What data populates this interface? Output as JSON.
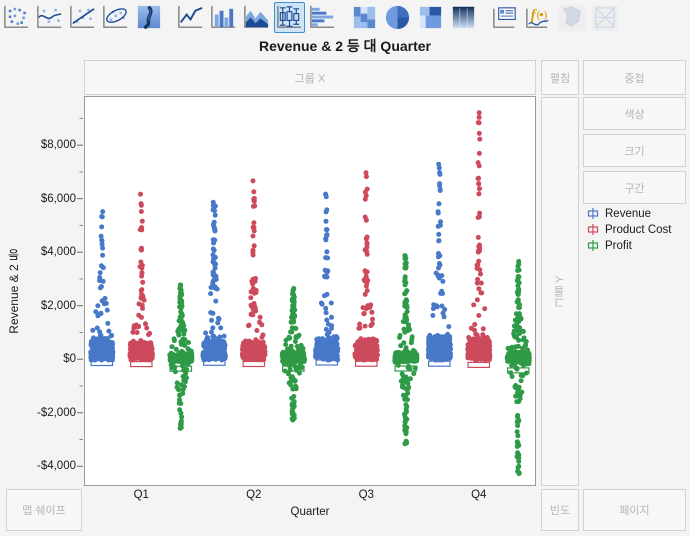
{
  "toolbar": {
    "groups": [
      {
        "name": "plot-types-1",
        "buttons": [
          {
            "icon": "scatterplot-icon",
            "label": "Scatterplot",
            "selected": false,
            "disabled": false
          },
          {
            "icon": "smoother-icon",
            "label": "Smoother",
            "selected": false,
            "disabled": false
          },
          {
            "icon": "line-of-fit-icon",
            "label": "Line of Fit",
            "selected": false,
            "disabled": false
          },
          {
            "icon": "ellipse-icon",
            "label": "Normal Ellipse",
            "selected": false,
            "disabled": false
          },
          {
            "icon": "contour-icon",
            "label": "Contour",
            "selected": false,
            "disabled": false
          }
        ]
      },
      {
        "name": "plot-types-2",
        "buttons": [
          {
            "icon": "line-chart-icon",
            "label": "Line Chart",
            "selected": false,
            "disabled": false
          },
          {
            "icon": "bar-chart-icon",
            "label": "Bar Chart",
            "selected": false,
            "disabled": false
          },
          {
            "icon": "area-chart-icon",
            "label": "Area Chart",
            "selected": false,
            "disabled": false
          },
          {
            "icon": "box-plot-icon",
            "label": "Box Plot",
            "selected": true,
            "disabled": false
          },
          {
            "icon": "histogram-icon",
            "label": "Histogram",
            "selected": false,
            "disabled": false
          }
        ]
      },
      {
        "name": "plot-types-3",
        "buttons": [
          {
            "icon": "mosaic-icon",
            "label": "Mosaic Plot",
            "selected": false,
            "disabled": false
          },
          {
            "icon": "pie-chart-icon",
            "label": "Pie Chart",
            "selected": false,
            "disabled": false
          },
          {
            "icon": "treemap-icon",
            "label": "Treemap",
            "selected": false,
            "disabled": false
          },
          {
            "icon": "heatmap-icon",
            "label": "Heatmap",
            "selected": false,
            "disabled": false
          }
        ]
      },
      {
        "name": "annotations",
        "buttons": [
          {
            "icon": "text-box-icon",
            "label": "Text Box",
            "selected": false,
            "disabled": false
          },
          {
            "icon": "formula-icon",
            "label": "Formula",
            "selected": false,
            "disabled": false
          },
          {
            "icon": "map-shape-icon",
            "label": "Map Shape",
            "selected": false,
            "disabled": true
          },
          {
            "icon": "parallel-plot-icon",
            "label": "Parallel Plot",
            "selected": false,
            "disabled": true
          }
        ]
      }
    ]
  },
  "title": "Revenue & 2 등 대 Quarter",
  "drop_zones": {
    "group_x": "그룹 X",
    "spread": "펼침",
    "overlay": "중첩",
    "color": "색상",
    "size": "크기",
    "interval": "구간",
    "group_y": "그룹 Y",
    "map_shape": "맵 쉐이프",
    "frequency": "빈도",
    "page": "페이지"
  },
  "legend": {
    "items": [
      {
        "label": "Revenue",
        "color": "#4878c8"
      },
      {
        "label": "Product Cost",
        "color": "#cc4a5c"
      },
      {
        "label": "Profit",
        "color": "#2f9a47"
      }
    ]
  },
  "chart_data": {
    "type": "scatter",
    "variant": "jitter-beeswarm-with-box",
    "title": "Revenue & 2 등 대 Quarter",
    "xlabel": "Quarter",
    "ylabel": "Revenue & 2 등",
    "grid": false,
    "legend_position": "right",
    "categories": [
      "Q1",
      "Q2",
      "Q3",
      "Q4"
    ],
    "yticks": [
      "$8,000",
      "$6,000",
      "$4,000",
      "$2,000",
      "$0",
      "-$2,000",
      "-$4,000"
    ],
    "ytick_values": [
      8000,
      6000,
      4000,
      2000,
      0,
      -2000,
      -4000
    ],
    "ylim": [
      -4700,
      9800
    ],
    "minor_ticks_per_interval": 1,
    "series": [
      {
        "name": "Revenue",
        "color": "#4878c8",
        "groups": [
          {
            "category": "Q1",
            "median": 250,
            "q1": 90,
            "q3": 560,
            "min": -30,
            "max": 5520,
            "n": 310,
            "tail_density": 0.8
          },
          {
            "category": "Q2",
            "median": 260,
            "q1": 95,
            "q3": 600,
            "min": -30,
            "max": 5980,
            "n": 320,
            "tail_density": 0.8
          },
          {
            "category": "Q3",
            "median": 270,
            "q1": 100,
            "q3": 620,
            "min": -30,
            "max": 6320,
            "n": 330,
            "tail_density": 0.82
          },
          {
            "category": "Q4",
            "median": 300,
            "q1": 110,
            "q3": 700,
            "min": -30,
            "max": 7570,
            "n": 360,
            "tail_density": 0.84
          }
        ]
      },
      {
        "name": "Product Cost",
        "color": "#cc4a5c",
        "groups": [
          {
            "category": "Q1",
            "median": 210,
            "q1": 75,
            "q3": 490,
            "min": -20,
            "max": 6180,
            "n": 305,
            "tail_density": 0.78
          },
          {
            "category": "Q2",
            "median": 215,
            "q1": 80,
            "q3": 520,
            "min": -20,
            "max": 6680,
            "n": 318,
            "tail_density": 0.78
          },
          {
            "category": "Q3",
            "median": 225,
            "q1": 85,
            "q3": 545,
            "min": -20,
            "max": 7140,
            "n": 328,
            "tail_density": 0.8
          },
          {
            "category": "Q4",
            "median": 255,
            "q1": 95,
            "q3": 600,
            "min": -20,
            "max": 9300,
            "n": 355,
            "tail_density": 0.82
          }
        ]
      },
      {
        "name": "Profit",
        "color": "#2f9a47",
        "groups": [
          {
            "category": "Q1",
            "median": 40,
            "q1": -60,
            "q3": 140,
            "min": -2600,
            "max": 2820,
            "n": 300,
            "tail_density": 0.55
          },
          {
            "category": "Q2",
            "median": 42,
            "q1": -62,
            "q3": 150,
            "min": -2420,
            "max": 2660,
            "n": 312,
            "tail_density": 0.55
          },
          {
            "category": "Q3",
            "median": 45,
            "q1": -65,
            "q3": 160,
            "min": -3380,
            "max": 3880,
            "n": 322,
            "tail_density": 0.57
          },
          {
            "category": "Q4",
            "median": 50,
            "q1": -70,
            "q3": 175,
            "min": -4280,
            "max": 3680,
            "n": 350,
            "tail_density": 0.6
          }
        ]
      }
    ]
  }
}
